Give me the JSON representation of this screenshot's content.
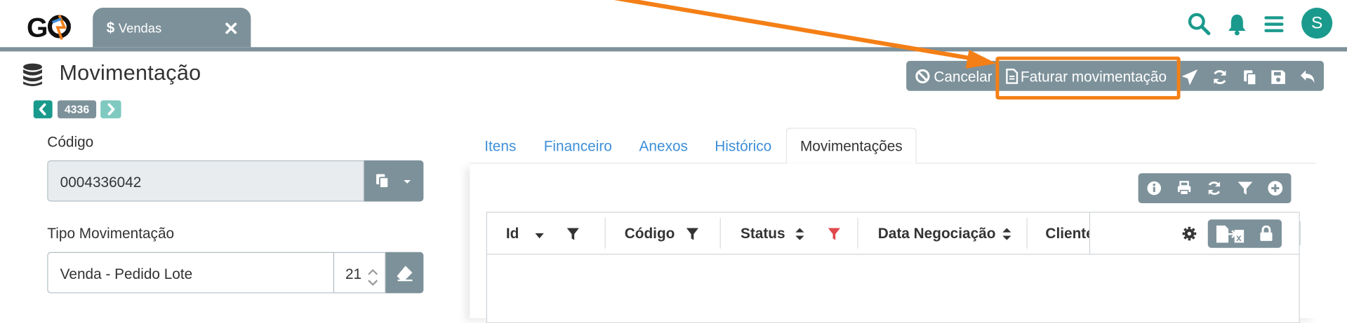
{
  "app": {
    "logo_text": "GO"
  },
  "tab": {
    "icon": "dollar-icon",
    "dollar": "$",
    "label": "Vendas",
    "close_icon": "close-icon"
  },
  "header_icons": [
    "search-icon",
    "bell-icon",
    "menu-icon"
  ],
  "user": {
    "avatar_letter": "S"
  },
  "page": {
    "title": "Movimentação",
    "icon": "database-icon",
    "record_id": "4336"
  },
  "toolbar": {
    "cancel_label": "Cancelar",
    "faturar_label": "Faturar movimentação",
    "icons": [
      "send-icon",
      "refresh-icon",
      "copy-icon",
      "save-icon",
      "undo-icon"
    ]
  },
  "form": {
    "codigo_label": "Código",
    "codigo_value": "0004336042",
    "tipo_label": "Tipo Movimentação",
    "tipo_value": "Venda - Pedido Lote",
    "tipo_number": "21"
  },
  "tabs": [
    {
      "label": "Itens"
    },
    {
      "label": "Financeiro"
    },
    {
      "label": "Anexos"
    },
    {
      "label": "Histórico"
    },
    {
      "label": "Movimentações",
      "active": true
    }
  ],
  "grid": {
    "toolbar_icons": [
      "info-icon",
      "print-icon",
      "refresh-icon",
      "filter-icon",
      "add-icon"
    ],
    "columns": [
      {
        "label": "Id"
      },
      {
        "label": "Código"
      },
      {
        "label": "Status"
      },
      {
        "label": "Data Negociação"
      },
      {
        "label": "Cliente"
      }
    ],
    "rows": []
  },
  "colors": {
    "accent": "#1a9a8c",
    "toolbar": "#7d919a",
    "highlight": "#f47f16",
    "link": "#3d8fd9",
    "filter_active": "#e0474c"
  }
}
